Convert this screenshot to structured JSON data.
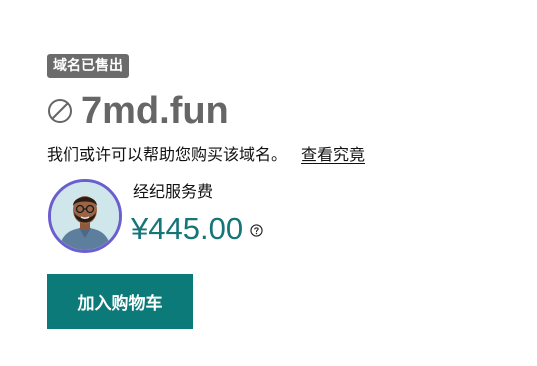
{
  "badge": {
    "label": "域名已售出"
  },
  "domain": {
    "name": "7md.fun",
    "status_icon": "ban-icon"
  },
  "description": {
    "text": "我们或许可以帮助您购买该域名。",
    "link_label": "查看究竟"
  },
  "broker": {
    "label": "经纪服务费",
    "price": "¥445.00",
    "help_icon": "question-circle-icon",
    "avatar_icon": "agent-avatar"
  },
  "actions": {
    "add_to_cart_label": "加入购物车"
  },
  "colors": {
    "badge_bg": "#6b6b6b",
    "domain_text": "#666666",
    "price_text": "#157577",
    "button_bg": "#0b7a78",
    "avatar_ring": "#6b5fd0"
  }
}
